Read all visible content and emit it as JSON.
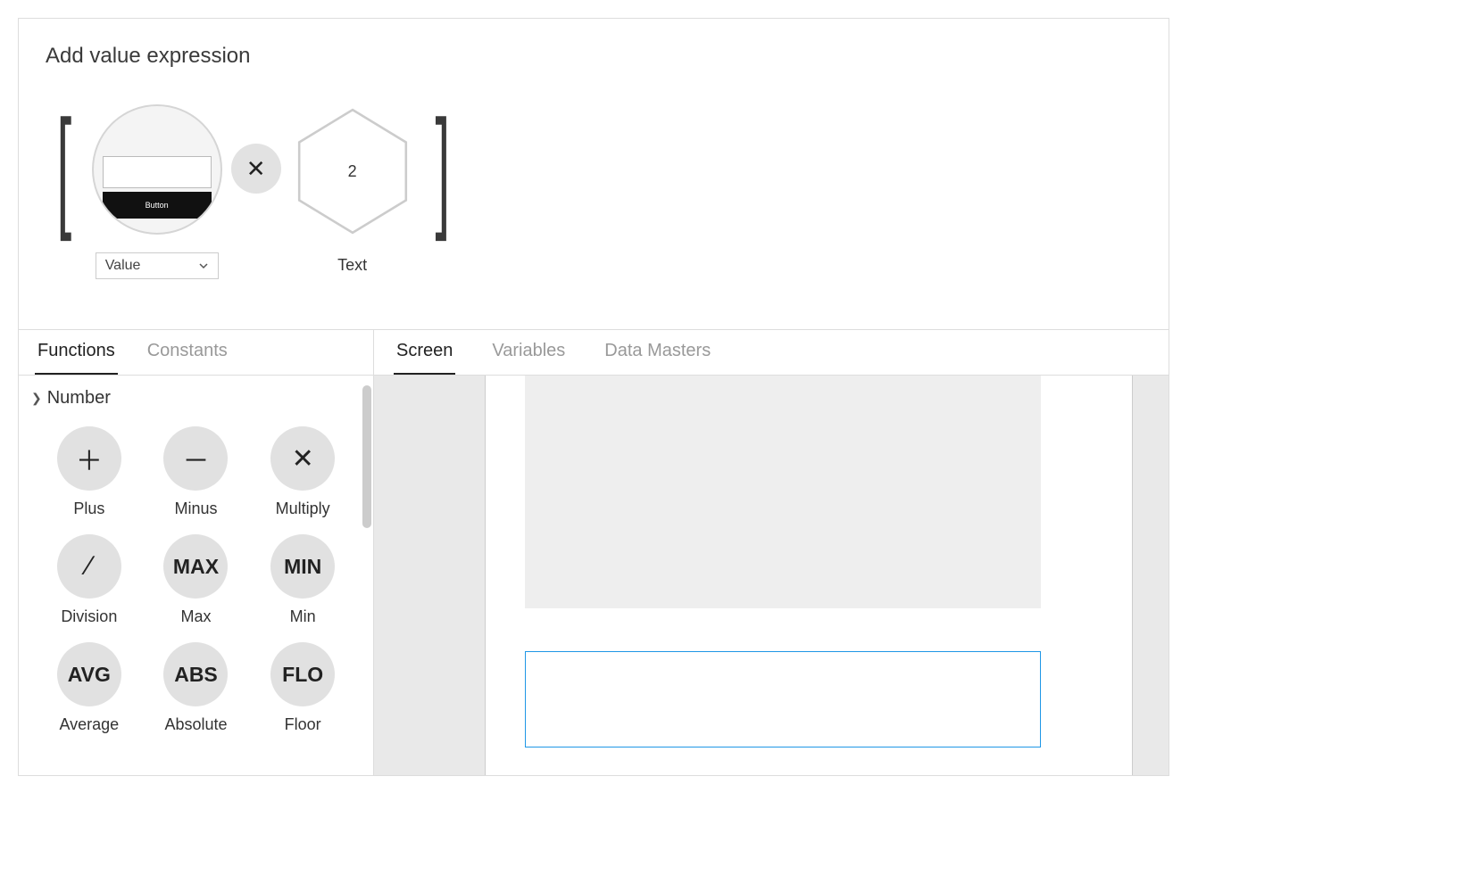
{
  "title": "Add value expression",
  "expression": {
    "element_preview_button_label": "Button",
    "dropdown_value": "Value",
    "operator_symbol": "✕",
    "constant_value": "2",
    "constant_caption": "Text"
  },
  "left_tabs": [
    {
      "label": "Functions",
      "active": true
    },
    {
      "label": "Constants",
      "active": false
    }
  ],
  "function_section_title": "Number",
  "functions": [
    {
      "icon": "＋",
      "label": "Plus",
      "symbol": true
    },
    {
      "icon": "－",
      "label": "Minus",
      "symbol": true
    },
    {
      "icon": "✕",
      "label": "Multiply",
      "symbol": true
    },
    {
      "icon": "∕",
      "label": "Division",
      "symbol": true
    },
    {
      "icon": "MAX",
      "label": "Max",
      "symbol": false
    },
    {
      "icon": "MIN",
      "label": "Min",
      "symbol": false
    },
    {
      "icon": "AVG",
      "label": "Average",
      "symbol": false
    },
    {
      "icon": "ABS",
      "label": "Absolute",
      "symbol": false
    },
    {
      "icon": "FLO",
      "label": "Floor",
      "symbol": false
    }
  ],
  "right_tabs": [
    {
      "label": "Screen",
      "active": true
    },
    {
      "label": "Variables",
      "active": false
    },
    {
      "label": "Data Masters",
      "active": false
    }
  ]
}
